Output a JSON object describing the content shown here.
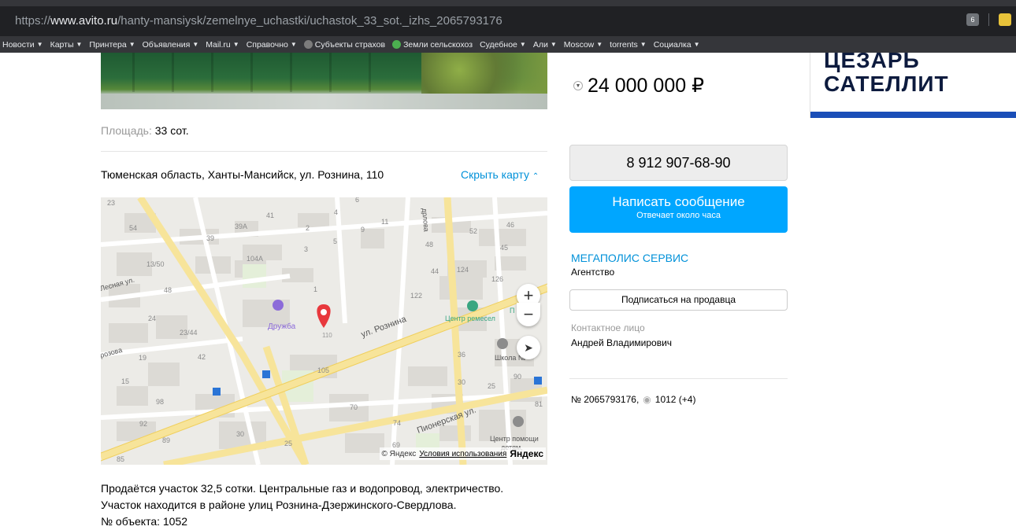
{
  "browser": {
    "url_prefix": "https://",
    "url_domain": "www.avito.ru",
    "url_path": "/hanty-mansiysk/zemelnye_uchastki/uchastok_33_sot._izhs_2065793176",
    "ext_badge": "6",
    "bookmarks": [
      {
        "label": "Новости",
        "has_menu": true
      },
      {
        "label": "Карты",
        "has_menu": true
      },
      {
        "label": "Принтера",
        "has_menu": true
      },
      {
        "label": "Объявления",
        "has_menu": true
      },
      {
        "label": "Mail.ru",
        "has_menu": true
      },
      {
        "label": "Справочно",
        "has_menu": true
      },
      {
        "label": "Субъекты страхов",
        "has_menu": false
      },
      {
        "label": "Земли сельскохоз",
        "has_menu": false
      },
      {
        "label": "Судебное",
        "has_menu": true
      },
      {
        "label": "Али",
        "has_menu": true
      },
      {
        "label": "Moscow",
        "has_menu": true
      },
      {
        "label": "torrents",
        "has_menu": true
      },
      {
        "label": "Социалка",
        "has_menu": true
      }
    ]
  },
  "listing": {
    "area_label": "Площадь:",
    "area_value": "33 сот.",
    "address": "Тюменская область, Ханты-Мансийск, ул. Рознина, 110",
    "hide_map_label": "Скрыть карту",
    "description_lines": [
      "Продаётся участок 32,5 сотки. Центральные газ и водопровод, электричество.",
      "Участок находится в районе улиц Рознина-Дзержинского-Свердлова.",
      "№ объекта: 1052"
    ]
  },
  "map": {
    "labels": {
      "druzhba": "Дружба",
      "rozn": "ул. Рознина",
      "center": "Центр ремесел",
      "school": "Школа №",
      "pioneer": "Пионерская ул.",
      "lesnaya": "Лесная ул.",
      "rozovaya": "розова",
      "help": "Центр помощи",
      "help2": "детям,",
      "sverdlova": "дрлова",
      "p_label": "П",
      "house110": "110"
    },
    "house_numbers": [
      "23",
      "41",
      "4",
      "6",
      "11",
      "54",
      "39А",
      "2",
      "9",
      "46",
      "39",
      "3",
      "5",
      "52",
      "48",
      "104А",
      "45",
      "13/50",
      "44",
      "124",
      "126",
      "48",
      "1",
      "122",
      "128",
      "24",
      "23/44",
      "19",
      "42",
      "36",
      "15",
      "105",
      "30",
      "90",
      "25",
      "98",
      "81",
      "70",
      "92",
      "74",
      "89",
      "30",
      "25",
      "69",
      "85"
    ],
    "copyright": "© Яндекс",
    "terms": "Условия использования",
    "brand": "Яндекс",
    "zoom_in": "+",
    "zoom_out": "−"
  },
  "sidebar": {
    "price": "24 000 000 ₽",
    "phone": "8 912 907-68-90",
    "message_title": "Написать сообщение",
    "message_sub": "Отвечает около часа",
    "seller_name": "МЕГАПОЛИС СЕРВИС",
    "seller_type": "Агентство",
    "subscribe": "Подписаться на продавца",
    "contact_label": "Контактное лицо",
    "contact_name": "Андрей Владимирович",
    "item_number": "№ 2065793176,",
    "views": "1012 (+4)"
  },
  "ad": {
    "line1": "ЦЕЗАРЬ",
    "line2": "САТЕЛЛИТ"
  },
  "colors": {
    "accent_blue": "#00a6ff",
    "link_blue": "#0091d9",
    "map_pin": "#e8383d"
  }
}
